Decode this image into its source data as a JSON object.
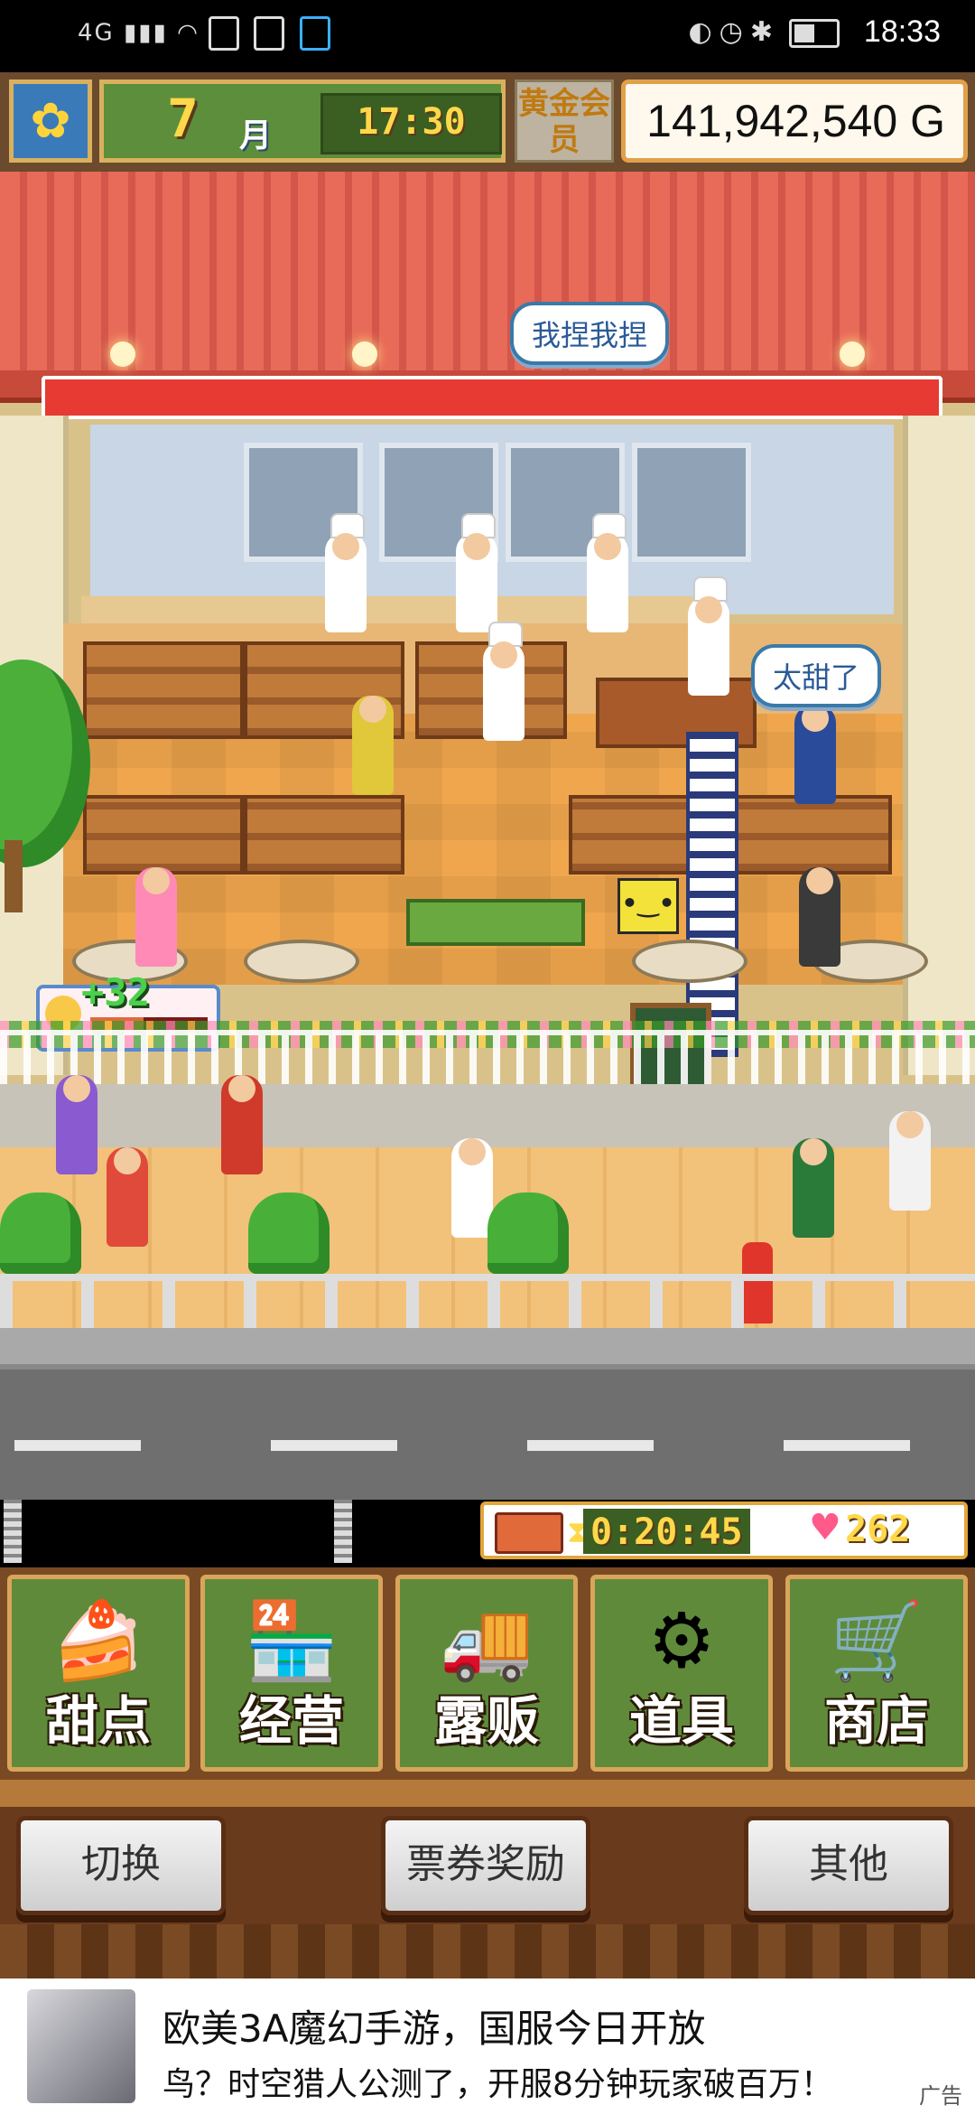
{
  "status_bar": {
    "left_text": "4G",
    "time": "18:33"
  },
  "hud": {
    "month_number": "7",
    "month_unit": "月",
    "clock": "17:30",
    "member_badge": "黄金会员",
    "money": "141,942,540 G"
  },
  "scene": {
    "speech_top": "我捏我捏",
    "speech_customer": "太甜了",
    "plus_popup": "+32",
    "plus_bar_level": 0.45
  },
  "strip": {
    "timer": "0:20:45",
    "hearts": "262"
  },
  "menu": {
    "items": [
      {
        "label": "甜点",
        "icon": "cake-icon"
      },
      {
        "label": "经营",
        "icon": "storefront-icon"
      },
      {
        "label": "露贩",
        "icon": "food-truck-icon"
      },
      {
        "label": "道具",
        "icon": "gear-bag-icon"
      },
      {
        "label": "商店",
        "icon": "shopping-cart-icon"
      }
    ]
  },
  "bottom_buttons": {
    "switch": "切换",
    "tickets": "票券奖励",
    "other": "其他"
  },
  "ad": {
    "title": "欧美3A魔幻手游，国服今日开放",
    "subtitle": "鸟？时空猎人公测了，开服8分钟玩家破百万！",
    "tag": "广告"
  },
  "colors": {
    "awning": "#e86a58",
    "hud_brown": "#6b4a2e",
    "menu_green": "#5f8a3a",
    "timer_yellow": "#ffd84a"
  }
}
